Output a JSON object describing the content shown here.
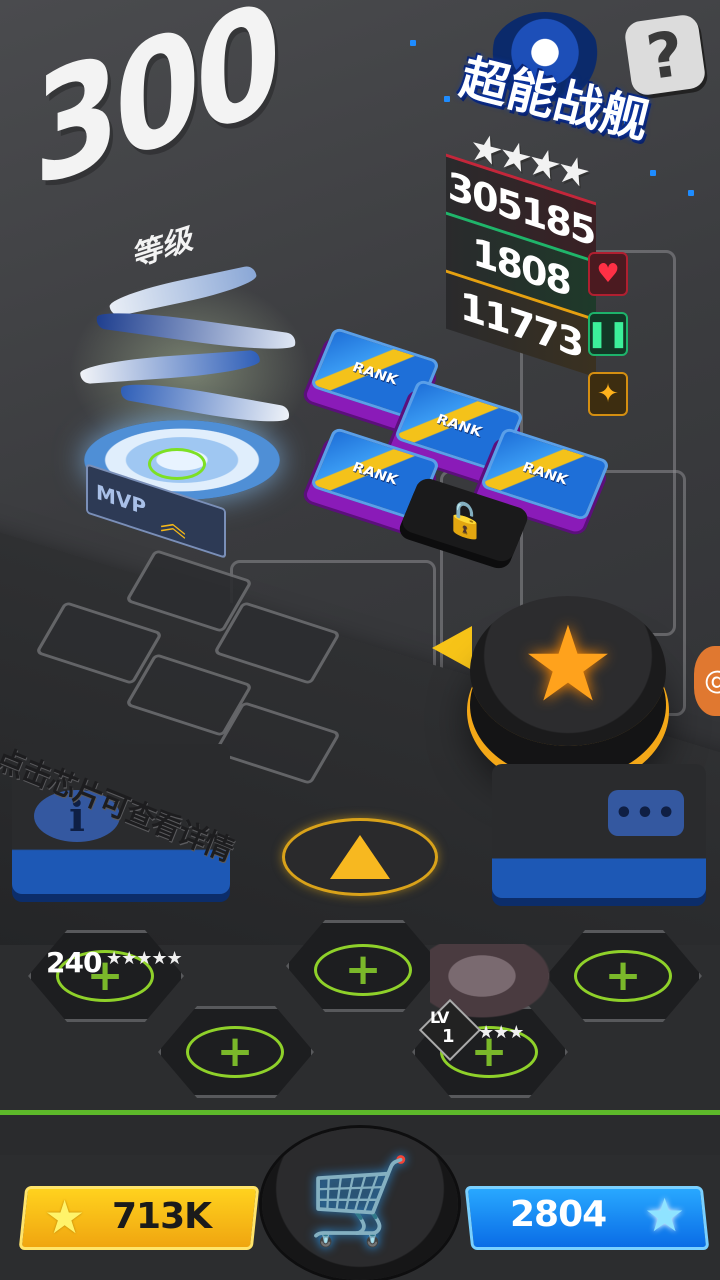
{
  "level": {
    "number": "300",
    "label": "等级"
  },
  "ship": {
    "name": "超能战舰",
    "stars": "★★★★",
    "base_badge": "MVP"
  },
  "stats": {
    "hp": "305185",
    "defense": "1808",
    "attack": "11773"
  },
  "icons": {
    "heart": "♥",
    "shield": "❚❚",
    "star": "✦",
    "lock": "🔓",
    "help": "?",
    "info": "i",
    "chat": "•••",
    "big_star": "★",
    "cart": "🛒",
    "upgrade_chevron": "︽",
    "edge": "@"
  },
  "chips": [
    {
      "label": "RANK"
    },
    {
      "label": "RANK"
    },
    {
      "label": "RANK"
    },
    {
      "label": "RANK"
    }
  ],
  "hint": "点击芯片可查看详情",
  "team": {
    "member1": {
      "level": "240",
      "stars": "★★★★★",
      "lv_prefix": "LV"
    },
    "member2": {
      "level": "1",
      "stars": "★★★",
      "lv_prefix": "LV"
    }
  },
  "currency": {
    "coins": "713K",
    "gems": "2804",
    "coin_star": "★",
    "gem_star": "★"
  },
  "colors": {
    "coins": "#f5b814",
    "gems": "#1a8cf2",
    "hp": "#c4263a",
    "defense": "#1fb56a",
    "attack": "#e5a010",
    "accent_plus": "#8fd12a"
  }
}
